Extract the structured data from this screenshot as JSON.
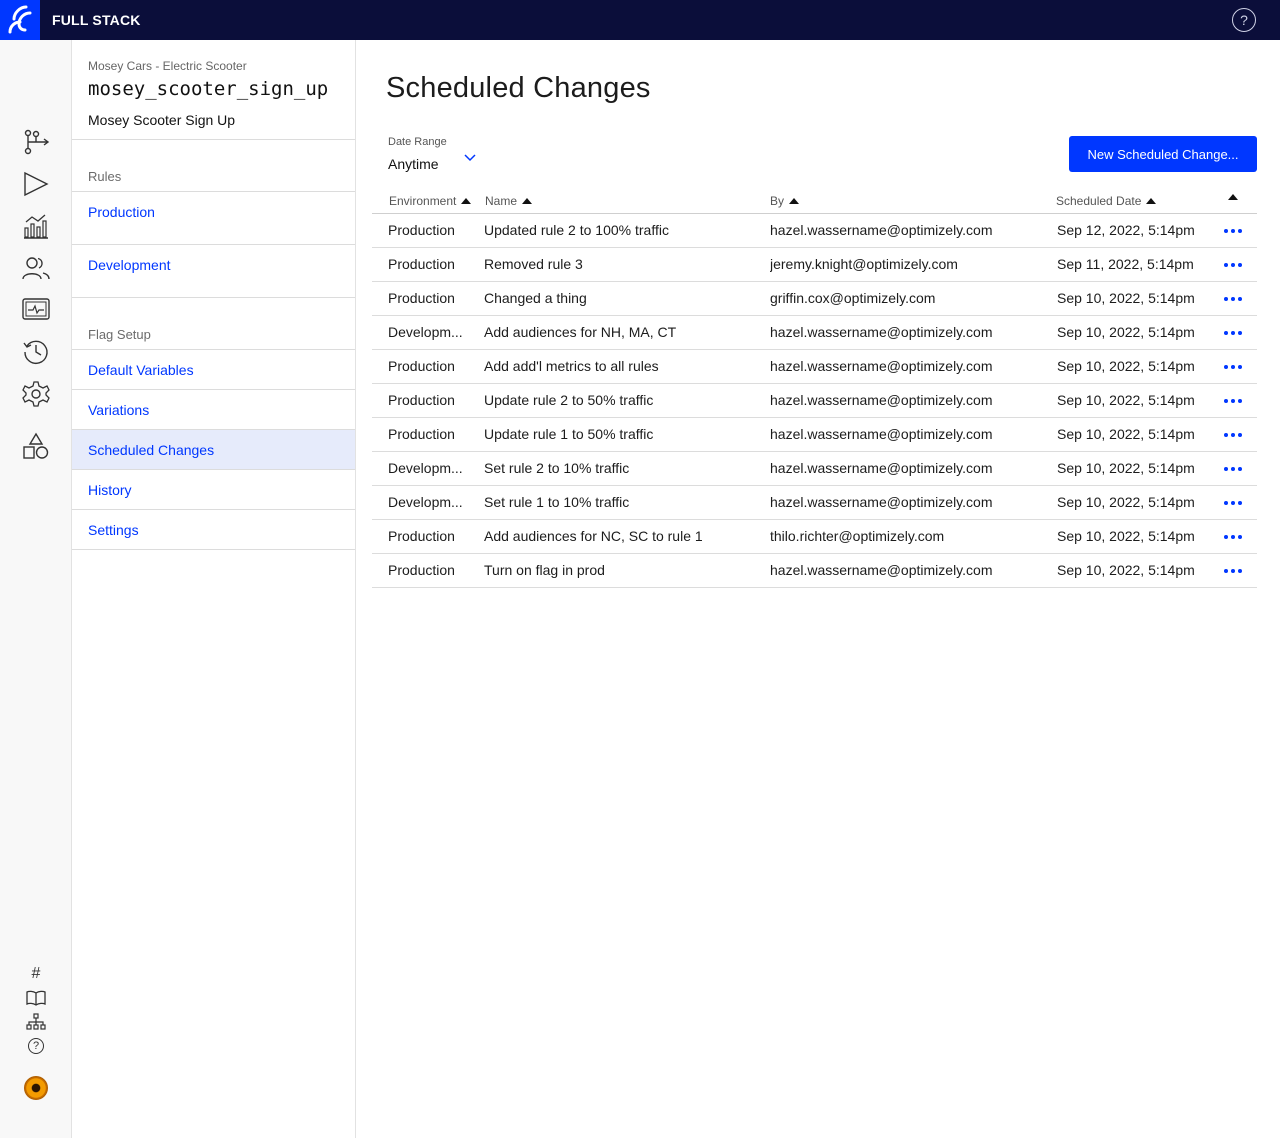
{
  "app": {
    "brand": "FULL STACK",
    "help_glyph": "?"
  },
  "rail": {
    "icons": [
      "flags-icon",
      "experiments-icon",
      "reports-icon",
      "audiences-icon",
      "events-icon",
      "history-icon",
      "settings-icon",
      "shapes-icon"
    ],
    "bottom": {
      "hash_glyph": "#",
      "help_glyph": "?"
    }
  },
  "panel": {
    "project": "Mosey Cars - Electric Scooter",
    "flag_key": "mosey_scooter_sign_up",
    "flag_name": "Mosey Scooter Sign Up",
    "rules_label": "Rules",
    "rules": [
      "Production",
      "Development"
    ],
    "flag_setup_label": "Flag Setup",
    "setup_items": [
      "Default Variables",
      "Variations",
      "Scheduled Changes",
      "History",
      "Settings"
    ],
    "active_item": "Scheduled Changes"
  },
  "main": {
    "title": "Scheduled Changes",
    "date_range": {
      "label": "Date Range",
      "value": "Anytime"
    },
    "new_button": "New Scheduled Change...",
    "columns": [
      "Environment",
      "Name",
      "By",
      "Scheduled Date"
    ],
    "rows": [
      {
        "env": "Production",
        "name": "Updated rule 2 to 100% traffic",
        "by": "hazel.wassername@optimizely.com",
        "date": "Sep 12, 2022, 5:14pm"
      },
      {
        "env": "Production",
        "name": "Removed rule 3",
        "by": "jeremy.knight@optimizely.com",
        "date": "Sep 11, 2022, 5:14pm"
      },
      {
        "env": "Production",
        "name": "Changed a thing",
        "by": "griffin.cox@optimizely.com",
        "date": "Sep 10, 2022, 5:14pm"
      },
      {
        "env": "Developm...",
        "name": "Add audiences for NH, MA, CT",
        "by": "hazel.wassername@optimizely.com",
        "date": "Sep 10, 2022, 5:14pm"
      },
      {
        "env": "Production",
        "name": "Add add'l metrics to all rules",
        "by": "hazel.wassername@optimizely.com",
        "date": "Sep 10, 2022, 5:14pm"
      },
      {
        "env": "Production",
        "name": "Update rule 2 to 50% traffic",
        "by": "hazel.wassername@optimizely.com",
        "date": "Sep 10, 2022, 5:14pm"
      },
      {
        "env": "Production",
        "name": "Update rule 1 to 50% traffic",
        "by": "hazel.wassername@optimizely.com",
        "date": "Sep 10, 2022, 5:14pm"
      },
      {
        "env": "Developm...",
        "name": "Set rule 2 to 10% traffic",
        "by": "hazel.wassername@optimizely.com",
        "date": "Sep 10, 2022, 5:14pm"
      },
      {
        "env": "Developm...",
        "name": "Set rule 1 to 10% traffic",
        "by": "hazel.wassername@optimizely.com",
        "date": "Sep 10, 2022, 5:14pm"
      },
      {
        "env": "Production",
        "name": "Add audiences for NC, SC to rule 1",
        "by": "thilo.richter@optimizely.com",
        "date": "Sep 10, 2022, 5:14pm"
      },
      {
        "env": "Production",
        "name": "Turn on flag in prod",
        "by": "hazel.wassername@optimizely.com",
        "date": "Sep 10, 2022, 5:14pm"
      }
    ]
  },
  "colors": {
    "brand_blue": "#0037ff",
    "topbar": "#0b0e3a",
    "active_bg": "#e6ebfb"
  }
}
